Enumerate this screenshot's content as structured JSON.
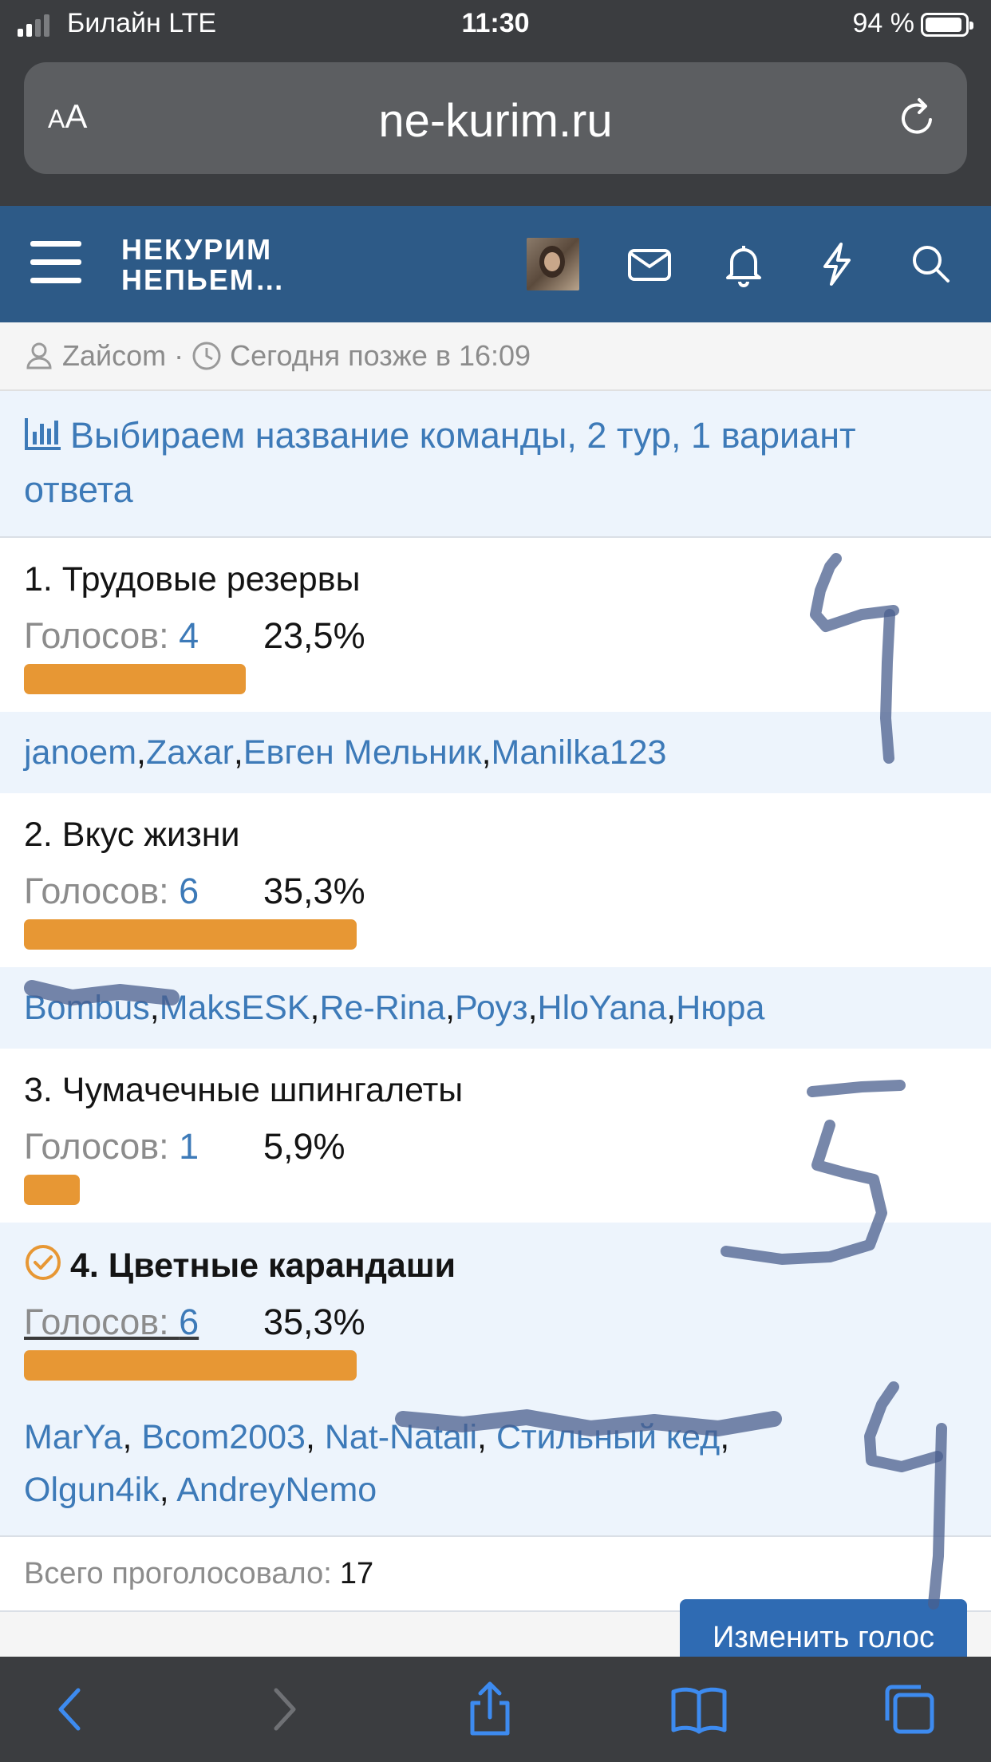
{
  "status": {
    "carrier": "Билайн  LTE",
    "time": "11:30",
    "battery_text": "94 %",
    "battery_level": 0.94
  },
  "browser": {
    "text_size_label": "AA",
    "url": "ne-kurim.ru"
  },
  "header": {
    "logo_line1": "НЕКУРИМ",
    "logo_line2": "НЕПЬЕМ…"
  },
  "thread_meta": {
    "author": "Zaйcom",
    "separator": "·",
    "time": "Сегодня позже в 16:09"
  },
  "poll": {
    "title": "Выбираем название команды, 2 тур, 1 вариант ответа",
    "votes_label": "Голосов: ",
    "options": [
      {
        "label": "1. Трудовые резервы",
        "votes": "4",
        "percent": "23,5%",
        "fill": 0.235,
        "voters": [
          "janoem",
          "Zaxar",
          "Евген Мельник",
          "Manilka123"
        ]
      },
      {
        "label": "2. Вкус жизни",
        "votes": "6",
        "percent": "35,3%",
        "fill": 0.353,
        "voters": [
          "Bombus",
          "MaksESK",
          "Re-Rina",
          "Роуз",
          "HloYana",
          "Нюра"
        ]
      },
      {
        "label": "3. Чумачечные шпингалеты",
        "votes": "1",
        "percent": "5,9%",
        "fill": 0.059,
        "voters": []
      },
      {
        "label": "4. Цветные карандаши",
        "votes": "6",
        "percent": "35,3%",
        "fill": 0.353,
        "voted": true,
        "voters": [
          "MarYa",
          "Bcom2003",
          "Nat-Natali",
          "Стильный кед",
          "Olgun4ik",
          "AndreyNemo"
        ]
      }
    ],
    "total_label": "Всего проголосовало:",
    "total": "17",
    "change_vote_label": "Изменить голос"
  },
  "colors": {
    "header_bg": "#2d5a87",
    "link": "#3d7ab8",
    "bar": "#e79734",
    "button": "#2f6bb3"
  },
  "icons": [
    "signal-icon",
    "battery-icon",
    "reload-icon",
    "menu-icon",
    "envelope-icon",
    "bell-icon",
    "lightning-icon",
    "search-icon",
    "user-icon",
    "clock-icon",
    "chart-icon",
    "check-circle-icon",
    "back-icon",
    "forward-icon",
    "share-icon",
    "bookmarks-icon",
    "tabs-icon"
  ],
  "handwritten_annotations": [
    "4",
    "5",
    "4"
  ]
}
